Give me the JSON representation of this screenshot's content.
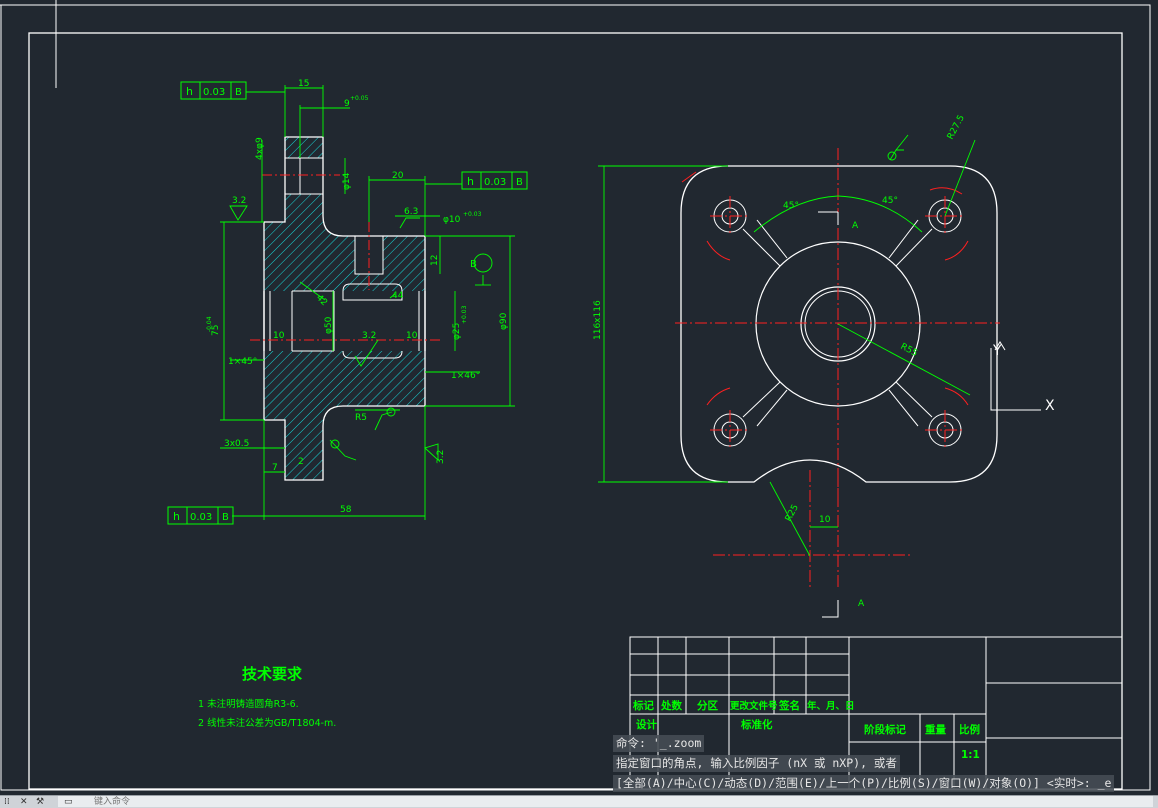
{
  "colors": {
    "background": "#212830",
    "drawing": "#ffffff",
    "dimension": "#00ff00",
    "centerline": "#ff2020",
    "hatch": "#18d6d6"
  },
  "drawing": {
    "gdt_1": {
      "sym": "h",
      "tol": "0.03",
      "ref": "B"
    },
    "gdt_2": {
      "sym": "h",
      "tol": "0.03",
      "ref": "B"
    },
    "gdt_3": {
      "sym": "h",
      "tol": "0.03",
      "ref": "B"
    },
    "datum_b": "B",
    "dims": {
      "d15": "15",
      "d9": "9",
      "d9tol": "+0.05",
      "d4x9": "4xφ9",
      "d14": "φ14",
      "d20": "20",
      "d32a": "3.2",
      "d63": "6.3",
      "d10tol": "φ10",
      "d10tol_s": "+0.03",
      "d12": "12",
      "d42": "42",
      "d44": "44",
      "d50": "φ50",
      "d10a": "10",
      "d10b": "10",
      "d32b": "3.2",
      "d25": "φ25",
      "d25tol": "+0.03",
      "d90": "φ90",
      "d75": "75",
      "d75tol": "-0.04",
      "c1x45a": "1×45°",
      "c1x45b": "1×46°",
      "r5": "R5",
      "d3x05": "3x0.5",
      "d7": "7",
      "d2": "2",
      "d58": "58",
      "d32c": "3.2",
      "d116": "116x116",
      "a45a": "45°",
      "a45b": "45°",
      "letterA1": "A",
      "letterA2": "A",
      "r27": "R27.5",
      "r55": "R55",
      "r25": "R25",
      "d10c": "10",
      "axisY": "Y",
      "axisX": "X"
    }
  },
  "tech": {
    "title": "技术要求",
    "item1": "1   未注明铸造圆角R3-6.",
    "item2": "2   线性未注公差为GB/T1804-m."
  },
  "title_block": {
    "biaoji": "标记",
    "chushu": "处数",
    "fenqu": "分区",
    "genggai": "更改文件号",
    "qianming": "签名",
    "nianyueri": "年、月、日",
    "sheji": "设计",
    "biaozhunhua": "标准化",
    "jieduan": "阶段标记",
    "zhongliang": "重量",
    "bili": "比例",
    "bili_val": "1:1"
  },
  "command": {
    "line1": "命令: '_.zoom",
    "line2": "指定窗口的角点, 输入比例因子 (nX 或 nXP), 或者",
    "line3": "[全部(A)/中心(C)/动态(D)/范围(E)/上一个(P)/比例(S)/窗口(W)/对象(O)] <实时>: _e",
    "placeholder": "键入命令"
  }
}
